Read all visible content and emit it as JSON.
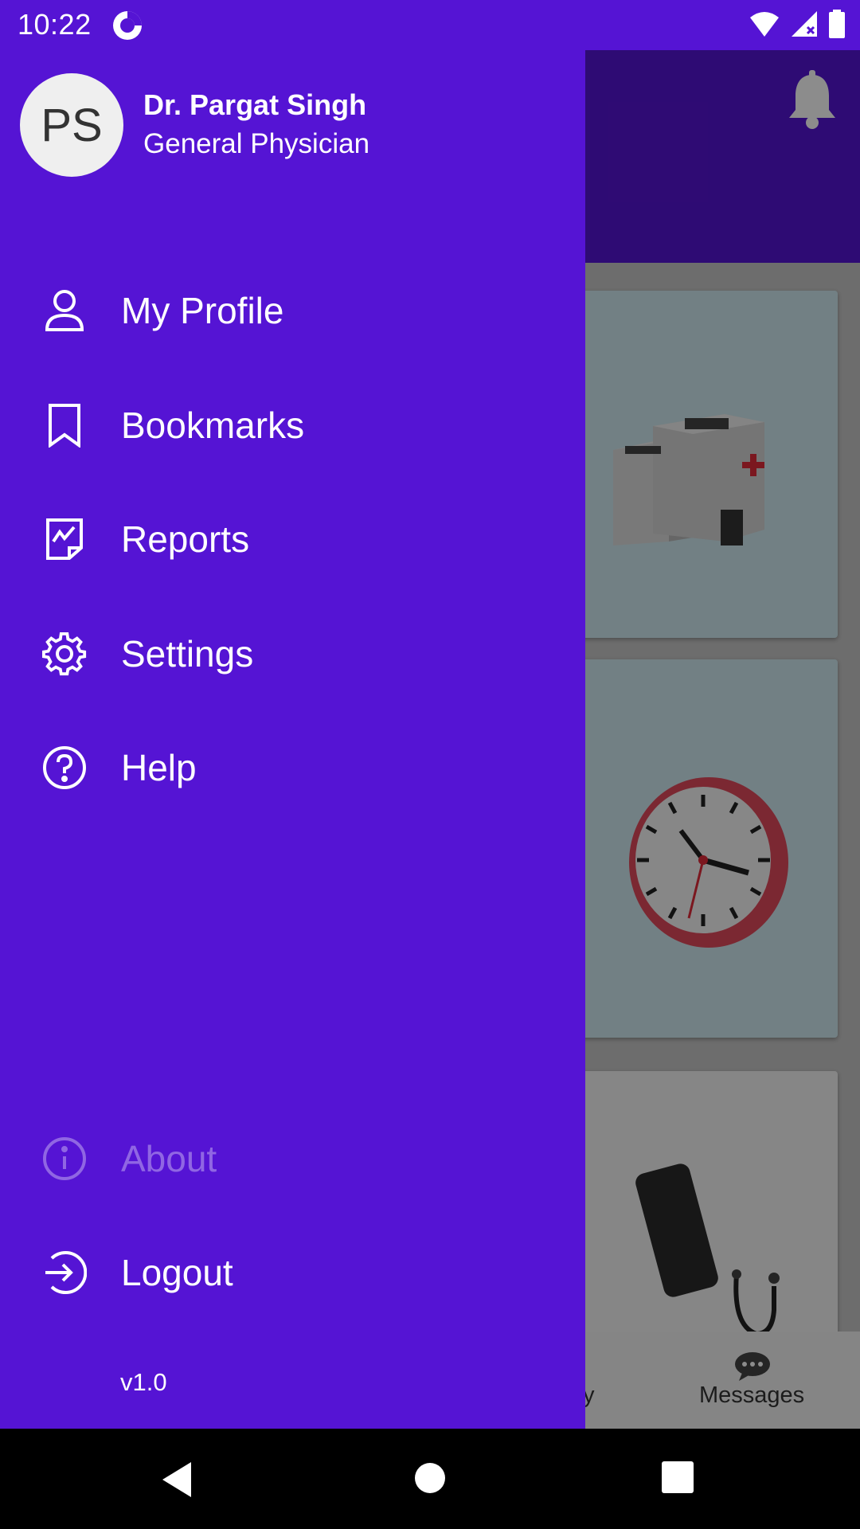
{
  "status_bar": {
    "time": "10:22"
  },
  "user": {
    "initials": "PS",
    "name": "Dr. Pargat Singh",
    "role": "General Physician"
  },
  "menu": {
    "items": [
      {
        "label": "My Profile",
        "icon": "person-icon"
      },
      {
        "label": "Bookmarks",
        "icon": "bookmark-icon"
      },
      {
        "label": "Reports",
        "icon": "report-chart-icon"
      },
      {
        "label": "Settings",
        "icon": "gear-icon"
      },
      {
        "label": "Help",
        "icon": "help-circle-icon"
      }
    ],
    "about": {
      "label": "About",
      "icon": "info-circle-icon",
      "disabled": true
    },
    "logout": {
      "label": "Logout",
      "icon": "logout-icon"
    }
  },
  "version": "v1.0",
  "background_app": {
    "bottom_nav": {
      "partial_label": "y",
      "messages_label": "Messages"
    }
  },
  "colors": {
    "primary": "#5514d4",
    "header_dark": "#2d0a6b",
    "on_primary": "#ffffff"
  }
}
